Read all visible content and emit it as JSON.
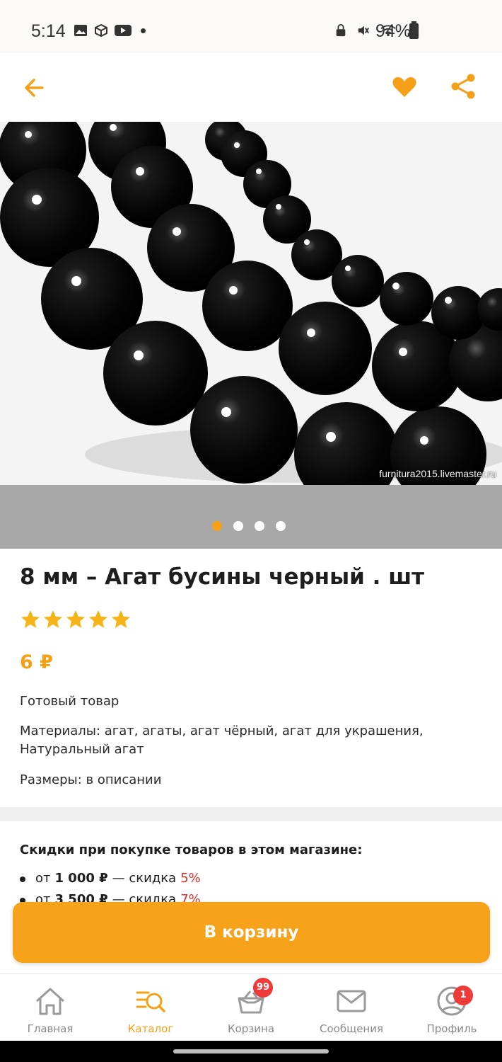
{
  "status_bar": {
    "time": "5:14",
    "battery": "94%"
  },
  "app_bar": {
    "back_icon": "arrow-left-icon",
    "favorite_icon": "heart-icon",
    "share_icon": "share-icon",
    "accent_color": "#f4a118"
  },
  "gallery": {
    "watermark": "furnitura2015.livemaster.ru",
    "page_count": 4,
    "active_page": 1
  },
  "product": {
    "title": "8 мм – Агат бусины черный . шт",
    "rating": 5,
    "rating_max": 5,
    "price": "6 ₽",
    "status": "Готовый товар",
    "materials": "Материалы: агат, агаты, агат чёрный, агат для украшения, Натуральный агат",
    "sizes": "Размеры: в описании"
  },
  "discounts": {
    "title": "Скидки при покупке товаров в этом магазине:",
    "items": [
      {
        "prefix": "от",
        "amount": "1 000 ₽",
        "sep": "— скидка",
        "percent": "5%"
      },
      {
        "prefix": "от",
        "amount": "3 500 ₽",
        "sep": "— скидка",
        "percent": "7%"
      }
    ]
  },
  "cart_button": {
    "label": "В корзину",
    "color": "#f6a31b"
  },
  "bottom_nav": {
    "items": [
      {
        "label": "Главная",
        "icon": "home-icon"
      },
      {
        "label": "Каталог",
        "icon": "catalog-search-icon"
      },
      {
        "label": "Корзина",
        "icon": "basket-icon",
        "badge": "99"
      },
      {
        "label": "Сообщения",
        "icon": "envelope-icon"
      },
      {
        "label": "Профиль",
        "icon": "profile-icon",
        "badge": "1"
      }
    ],
    "active_index": 1
  }
}
